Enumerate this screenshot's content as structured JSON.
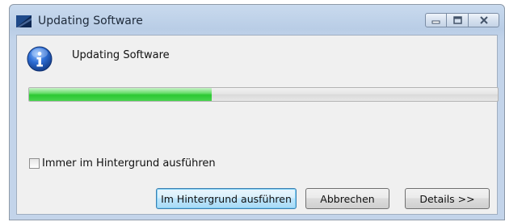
{
  "window": {
    "title": "Updating Software",
    "controls": [
      "minimize",
      "maximize",
      "close"
    ]
  },
  "dialog": {
    "heading": "Updating Software",
    "icon": "info-icon",
    "progress_fraction": 0.39,
    "checkbox": {
      "label": "Immer im Hintergrund ausführen",
      "checked": false
    },
    "buttons": {
      "background": "Im Hintergrund ausführen",
      "cancel": "Abbrechen",
      "details": "Details >>"
    }
  },
  "colors": {
    "progress": "#2cc832",
    "accent": "#3c7fb1"
  }
}
